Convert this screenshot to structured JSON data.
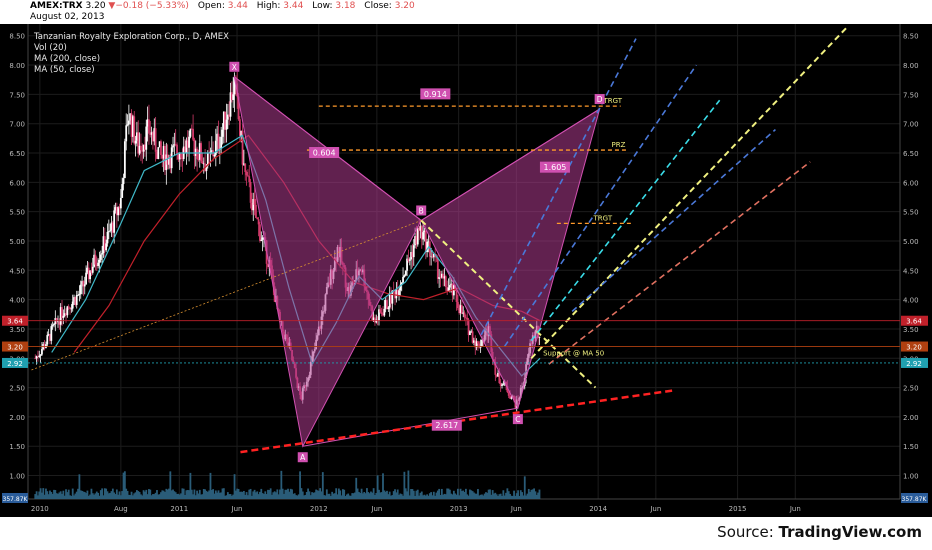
{
  "header": {
    "symbol": "AMEX:TRX",
    "price": "3.20",
    "change": "▼−0.18 (−5.33%)",
    "open_label": "Open:",
    "open": "3.44",
    "high_label": "High:",
    "high": "3.44",
    "low_label": "Low:",
    "low": "3.18",
    "close_label": "Close:",
    "close": "3.20",
    "date": "August 02, 2013"
  },
  "legend": {
    "title": "Tanzanian Royalty Exploration Corp., D, AMEX",
    "studies": [
      "Vol (20)",
      "MA (200, close)",
      "MA (50, close)"
    ]
  },
  "footer": {
    "source_prefix": "Source: ",
    "source_brand": "TradingView.com"
  },
  "colors": {
    "background": "#000000",
    "grid": "#1c1c1c",
    "candle_up": "#ffffff",
    "candle_down": "#d33a6a",
    "ma50": "#3fb8c8",
    "ma200": "#c0202a",
    "pattern_fill": "#b03d8f",
    "pattern_line": "#d050b0",
    "level_line": "#ff9a2a",
    "support_line": "#ff2222",
    "trend_line": "#f0f080",
    "volume": "#2a5c78"
  },
  "chart_data": {
    "type": "candlestick",
    "title": "Tanzanian Royalty Exploration Corp., D, AMEX",
    "y_axis": {
      "range": [
        0.6,
        8.7
      ],
      "ticks": [
        "1.00",
        "1.50",
        "2.00",
        "2.50",
        "3.00",
        "3.50",
        "4.00",
        "4.50",
        "5.00",
        "5.50",
        "6.00",
        "6.50",
        "7.00",
        "7.50",
        "8.00",
        "8.50"
      ]
    },
    "x_axis": {
      "ticks": [
        "2010",
        "Aug",
        "2011",
        "Jun",
        "2012",
        "Jun",
        "2013",
        "Jun",
        "2014",
        "Jun",
        "2015",
        "Jun"
      ]
    },
    "price_labels": [
      {
        "value": 3.64,
        "text": "3.64",
        "color": "#c0202a"
      },
      {
        "value": 3.2,
        "text": "3.20",
        "color": "#b04010"
      },
      {
        "value": 2.92,
        "text": "2.92",
        "color": "#20a0b0"
      }
    ],
    "volume_label": "357.87K",
    "price_path": [
      [
        "2009-12-20",
        3.0
      ],
      [
        "2010-01-20",
        3.3
      ],
      [
        "2010-03-01",
        3.8
      ],
      [
        "2010-04-15",
        4.1
      ],
      [
        "2010-05-20",
        4.6
      ],
      [
        "2010-07-01",
        5.1
      ],
      [
        "2010-08-01",
        5.7
      ],
      [
        "2010-08-20",
        7.2
      ],
      [
        "2010-09-15",
        6.6
      ],
      [
        "2010-10-15",
        6.9
      ],
      [
        "2010-11-15",
        6.4
      ],
      [
        "2010-12-20",
        6.5
      ],
      [
        "2011-02-01",
        6.7
      ],
      [
        "2011-03-15",
        6.3
      ],
      [
        "2011-04-20",
        6.8
      ],
      [
        "2011-05-25",
        7.7
      ],
      [
        "2011-06-20",
        6.2
      ],
      [
        "2011-07-20",
        5.4
      ],
      [
        "2011-08-25",
        4.6
      ],
      [
        "2011-09-20",
        3.6
      ],
      [
        "2011-10-15",
        3.2
      ],
      [
        "2011-11-15",
        2.3
      ],
      [
        "2011-12-20",
        3.1
      ],
      [
        "2012-01-25",
        4.2
      ],
      [
        "2012-02-20",
        4.9
      ],
      [
        "2012-03-20",
        4.1
      ],
      [
        "2012-04-20",
        4.6
      ],
      [
        "2012-05-25",
        3.6
      ],
      [
        "2012-06-25",
        3.9
      ],
      [
        "2012-07-25",
        4.2
      ],
      [
        "2012-08-25",
        4.7
      ],
      [
        "2012-09-20",
        5.2
      ],
      [
        "2012-10-20",
        4.8
      ],
      [
        "2012-11-20",
        4.3
      ],
      [
        "2012-12-20",
        4.1
      ],
      [
        "2013-01-20",
        3.6
      ],
      [
        "2013-02-20",
        3.2
      ],
      [
        "2013-03-20",
        3.5
      ],
      [
        "2013-04-10",
        2.7
      ],
      [
        "2013-05-05",
        2.5
      ],
      [
        "2013-06-01",
        2.2
      ],
      [
        "2013-06-20",
        2.6
      ],
      [
        "2013-07-10",
        3.3
      ],
      [
        "2013-07-25",
        3.5
      ],
      [
        "2013-08-02",
        3.2
      ]
    ],
    "ma50_path": [
      [
        "2010-02-01",
        3.1
      ],
      [
        "2010-05-01",
        4.0
      ],
      [
        "2010-08-01",
        5.3
      ],
      [
        "2010-10-01",
        6.2
      ],
      [
        "2011-01-01",
        6.5
      ],
      [
        "2011-04-01",
        6.5
      ],
      [
        "2011-06-15",
        6.8
      ],
      [
        "2011-08-15",
        5.7
      ],
      [
        "2011-10-15",
        4.2
      ],
      [
        "2011-12-15",
        2.9
      ],
      [
        "2012-02-15",
        3.6
      ],
      [
        "2012-04-15",
        4.4
      ],
      [
        "2012-06-15",
        4.0
      ],
      [
        "2012-08-15",
        4.3
      ],
      [
        "2012-10-15",
        4.9
      ],
      [
        "2012-12-15",
        4.4
      ],
      [
        "2013-02-15",
        3.7
      ],
      [
        "2013-04-15",
        3.2
      ],
      [
        "2013-06-15",
        2.7
      ],
      [
        "2013-08-02",
        3.0
      ]
    ],
    "ma200_path": [
      [
        "2010-04-01",
        3.1
      ],
      [
        "2010-07-01",
        3.9
      ],
      [
        "2010-10-01",
        5.0
      ],
      [
        "2011-01-01",
        5.8
      ],
      [
        "2011-04-01",
        6.4
      ],
      [
        "2011-07-01",
        6.8
      ],
      [
        "2011-10-01",
        6.0
      ],
      [
        "2012-01-01",
        5.0
      ],
      [
        "2012-04-01",
        4.3
      ],
      [
        "2012-07-01",
        4.1
      ],
      [
        "2012-10-01",
        4.0
      ],
      [
        "2013-01-01",
        4.2
      ],
      [
        "2013-04-01",
        3.9
      ],
      [
        "2013-06-15",
        3.8
      ],
      [
        "2013-08-02",
        3.64
      ]
    ],
    "pattern": {
      "points": [
        {
          "label": "X",
          "date": "2011-05-25",
          "value": 7.8
        },
        {
          "label": "A",
          "date": "2011-11-20",
          "value": 1.5
        },
        {
          "label": "B",
          "date": "2012-09-25",
          "value": 5.35
        },
        {
          "label": "C",
          "date": "2013-06-05",
          "value": 2.15
        },
        {
          "label": "D",
          "date": "2014-01-05",
          "value": 7.25
        }
      ],
      "ratios": [
        {
          "text": "0.914",
          "date": "2012-11-01",
          "value": 7.5
        },
        {
          "text": "0.604",
          "date": "2012-01-15",
          "value": 6.5
        },
        {
          "text": "1.605",
          "date": "2013-09-10",
          "value": 6.25
        },
        {
          "text": "2.617",
          "date": "2012-12-01",
          "value": 1.85
        }
      ]
    },
    "levels": [
      {
        "from": "2012-01-01",
        "to": "2014-03-01",
        "value": 7.3,
        "text": "TRGT",
        "text_date": "2014-01-15"
      },
      {
        "from": "2011-12-01",
        "to": "2014-03-15",
        "value": 6.55,
        "text": "PRZ",
        "text_date": "2014-02-05"
      },
      {
        "from": "2013-09-15",
        "to": "2014-04-01",
        "value": 5.3,
        "text": "TRGT",
        "text_date": "2013-12-20"
      }
    ],
    "support": {
      "from": "2011-06-10",
      "to": "2014-07-15",
      "from_value": 1.4,
      "to_value": 2.45
    },
    "trend_lines": [
      {
        "from": "2012-09-25",
        "from_value": 5.35,
        "to": "2013-12-25",
        "to_value": 2.5,
        "style": "yellow"
      },
      {
        "from": "2013-07-10",
        "from_value": 3.0,
        "to": "2015-10-15",
        "to_value": 8.65,
        "style": "yellow"
      },
      {
        "from": "2009-12-10",
        "from_value": 2.8,
        "to": "2012-09-25",
        "to_value": 5.35,
        "style": "orange"
      }
    ],
    "channel_lines": [
      {
        "from": "2013-03-01",
        "from_value": 3.4,
        "to": "2014-04-10",
        "to_value": 8.45,
        "color": "#4a78d8"
      },
      {
        "from": "2013-05-01",
        "from_value": 3.2,
        "to": "2014-09-15",
        "to_value": 8.0,
        "color": "#4a78d8"
      },
      {
        "from": "2013-07-10",
        "from_value": 3.3,
        "to": "2014-11-15",
        "to_value": 7.4,
        "color": "#3adce8"
      },
      {
        "from": "2013-10-25",
        "from_value": 3.8,
        "to": "2015-04-10",
        "to_value": 6.9,
        "color": "#4a78d8"
      },
      {
        "from": "2013-08-25",
        "from_value": 2.9,
        "to": "2015-07-10",
        "to_value": 6.35,
        "color": "#e07060"
      }
    ],
    "annotations": [
      {
        "text": "Support @ MA 50",
        "date": "2013-08-10",
        "value": 3.05
      }
    ]
  }
}
